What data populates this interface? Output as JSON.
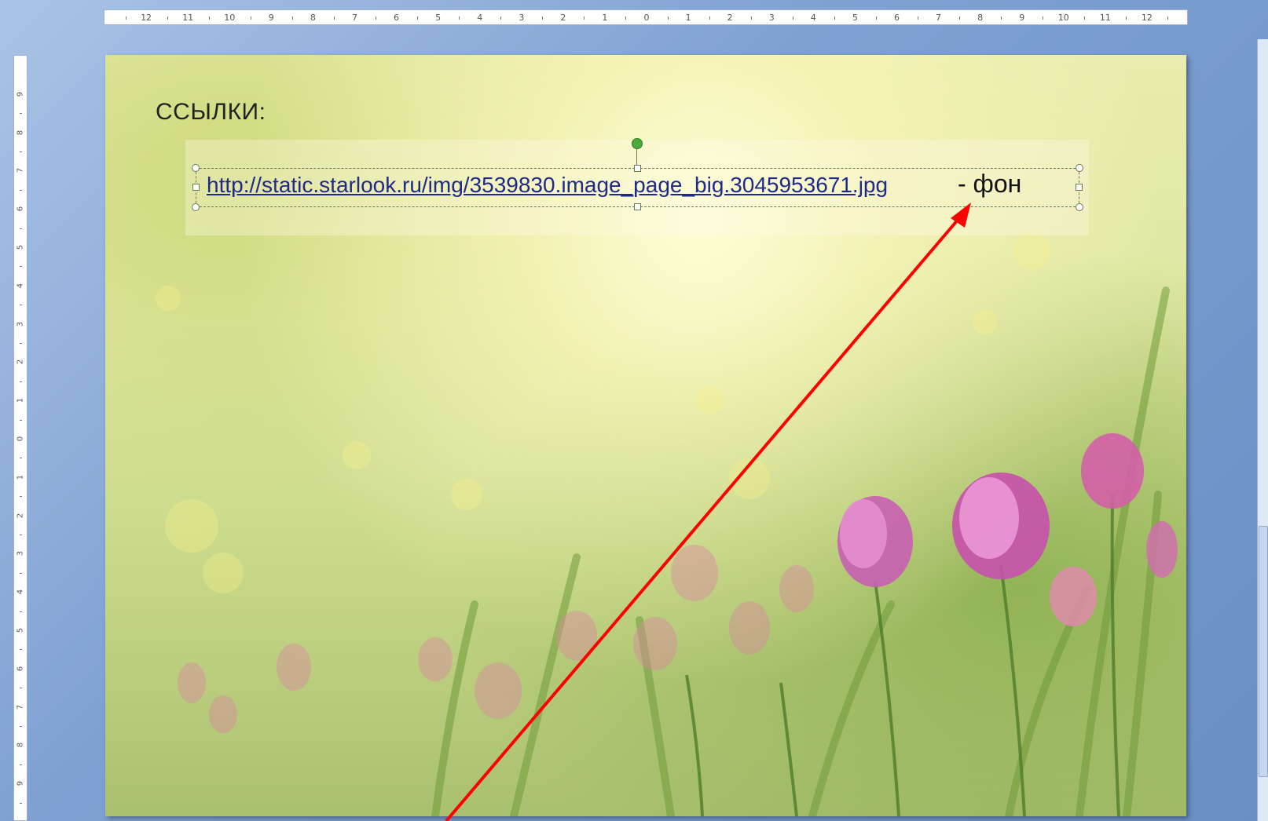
{
  "ruler": {
    "horizontal_labels": [
      "12",
      "11",
      "10",
      "9",
      "8",
      "7",
      "6",
      "5",
      "4",
      "3",
      "2",
      "1",
      "0",
      "1",
      "2",
      "3",
      "4",
      "5",
      "6",
      "7",
      "8",
      "9",
      "10",
      "11",
      "12"
    ],
    "vertical_labels": [
      "9",
      "8",
      "7",
      "6",
      "5",
      "4",
      "3",
      "2",
      "1",
      "0",
      "1",
      "2",
      "3",
      "4",
      "5",
      "6",
      "7",
      "8",
      "9"
    ]
  },
  "slide": {
    "title": "ССЫЛКИ:",
    "link_text": "http://static.starlook.ru/img/3539830.image_page_big.3045953671.jpg",
    "link_suffix": "- фон"
  },
  "annotation": {
    "arrow_color": "#ff0000"
  }
}
